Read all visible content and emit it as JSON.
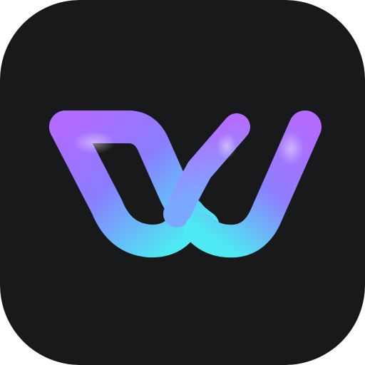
{
  "app_icon": {
    "logo_icon": "stylized-w-logo-icon",
    "colors": {
      "background": "#17191b",
      "gradient_start": "#b06bff",
      "gradient_mid": "#6f8bff",
      "gradient_end": "#4ee9f2",
      "highlight": "#f4eeff"
    }
  }
}
